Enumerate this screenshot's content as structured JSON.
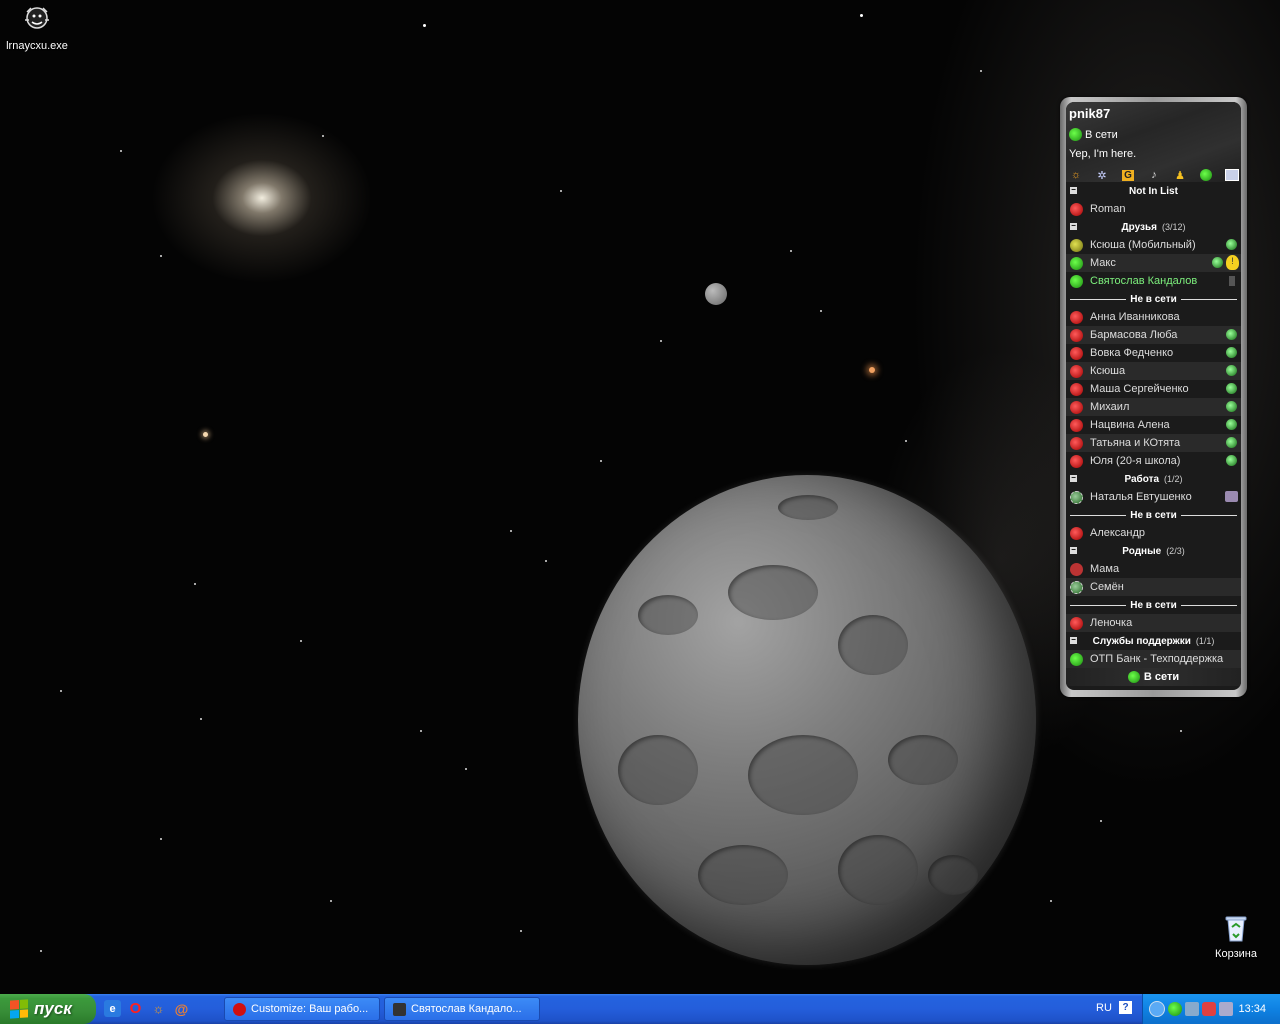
{
  "desktop": {
    "icons": [
      {
        "label": "lrnaycxu.exe"
      },
      {
        "label": "Корзина"
      }
    ]
  },
  "clist": {
    "nick": "pnik87",
    "status": "В сети",
    "status_message": "Yep, I'm here.",
    "toolbar_icons": [
      "miranda-icon",
      "options-gear-icon",
      "g-icon",
      "sound-icon",
      "find-user-icon",
      "status-icon",
      "minimize-icon"
    ],
    "rows": [
      {
        "type": "group",
        "label": "Not In List",
        "count": ""
      },
      {
        "type": "contact",
        "label": "Roman",
        "status": "offline"
      },
      {
        "type": "group",
        "label": "Друзья",
        "count": "(3/12)"
      },
      {
        "type": "contact",
        "label": "Ксюша (Мобильный)",
        "status": "mobile",
        "extra": "dot"
      },
      {
        "type": "contact",
        "label": "Макс",
        "status": "online",
        "extra": "dot-bulb"
      },
      {
        "type": "contact",
        "label": "Святослав Кандалов",
        "status": "online",
        "extra": "dim",
        "green": true
      },
      {
        "type": "divider",
        "label": "Не в сети"
      },
      {
        "type": "contact",
        "label": "Анна Иванникова",
        "status": "offline"
      },
      {
        "type": "contact",
        "label": "Бармасова Люба",
        "status": "offline",
        "extra": "dot"
      },
      {
        "type": "contact",
        "label": "Вовка Федченко",
        "status": "offline",
        "extra": "dot"
      },
      {
        "type": "contact",
        "label": "Ксюша",
        "status": "offline",
        "extra": "dot"
      },
      {
        "type": "contact",
        "label": "Маша Сергейченко",
        "status": "offline",
        "extra": "dot"
      },
      {
        "type": "contact",
        "label": "Михаил",
        "status": "offline",
        "extra": "dot"
      },
      {
        "type": "contact",
        "label": "Нацвина Алена",
        "status": "offline",
        "extra": "dot"
      },
      {
        "type": "contact",
        "label": "Татьяна и КОтята",
        "status": "offline",
        "extra": "dot"
      },
      {
        "type": "contact",
        "label": "Юля (20-я школа)",
        "status": "offline",
        "extra": "dot"
      },
      {
        "type": "group",
        "label": "Работа",
        "count": "(1/2)"
      },
      {
        "type": "contact",
        "label": "Наталья Евтушенко",
        "status": "na",
        "extra": "tv"
      },
      {
        "type": "divider",
        "label": "Не в сети"
      },
      {
        "type": "contact",
        "label": "Александр",
        "status": "offline"
      },
      {
        "type": "group",
        "label": "Родные",
        "count": "(2/3)"
      },
      {
        "type": "contact",
        "label": "Мама",
        "status": "sms"
      },
      {
        "type": "contact",
        "label": "Семён",
        "status": "na"
      },
      {
        "type": "divider",
        "label": "Не в сети"
      },
      {
        "type": "contact",
        "label": "Леночка",
        "status": "offline"
      },
      {
        "type": "group",
        "label": "Службы поддержки",
        "count": "(1/1)"
      },
      {
        "type": "contact",
        "label": "ОТП Банк - Техподдержка",
        "status": "online"
      }
    ],
    "footer_status": "В сети"
  },
  "taskbar": {
    "start_label": "пуск",
    "quicklaunch": [
      "ie-icon",
      "opera-icon",
      "miranda-icon",
      "mail-agent-icon"
    ],
    "tasks": [
      {
        "label": "Customize: Ваш рабо...",
        "icon_color": "#d01010"
      },
      {
        "label": "Святослав Кандало...",
        "icon_color": "#333333"
      }
    ],
    "language": "RU",
    "clock": "13:34"
  },
  "colors": {
    "taskbar": "#245edb",
    "start": "#378d37",
    "tray": "#0f82e3",
    "online": "#2cc010",
    "offline": "#c00000"
  }
}
